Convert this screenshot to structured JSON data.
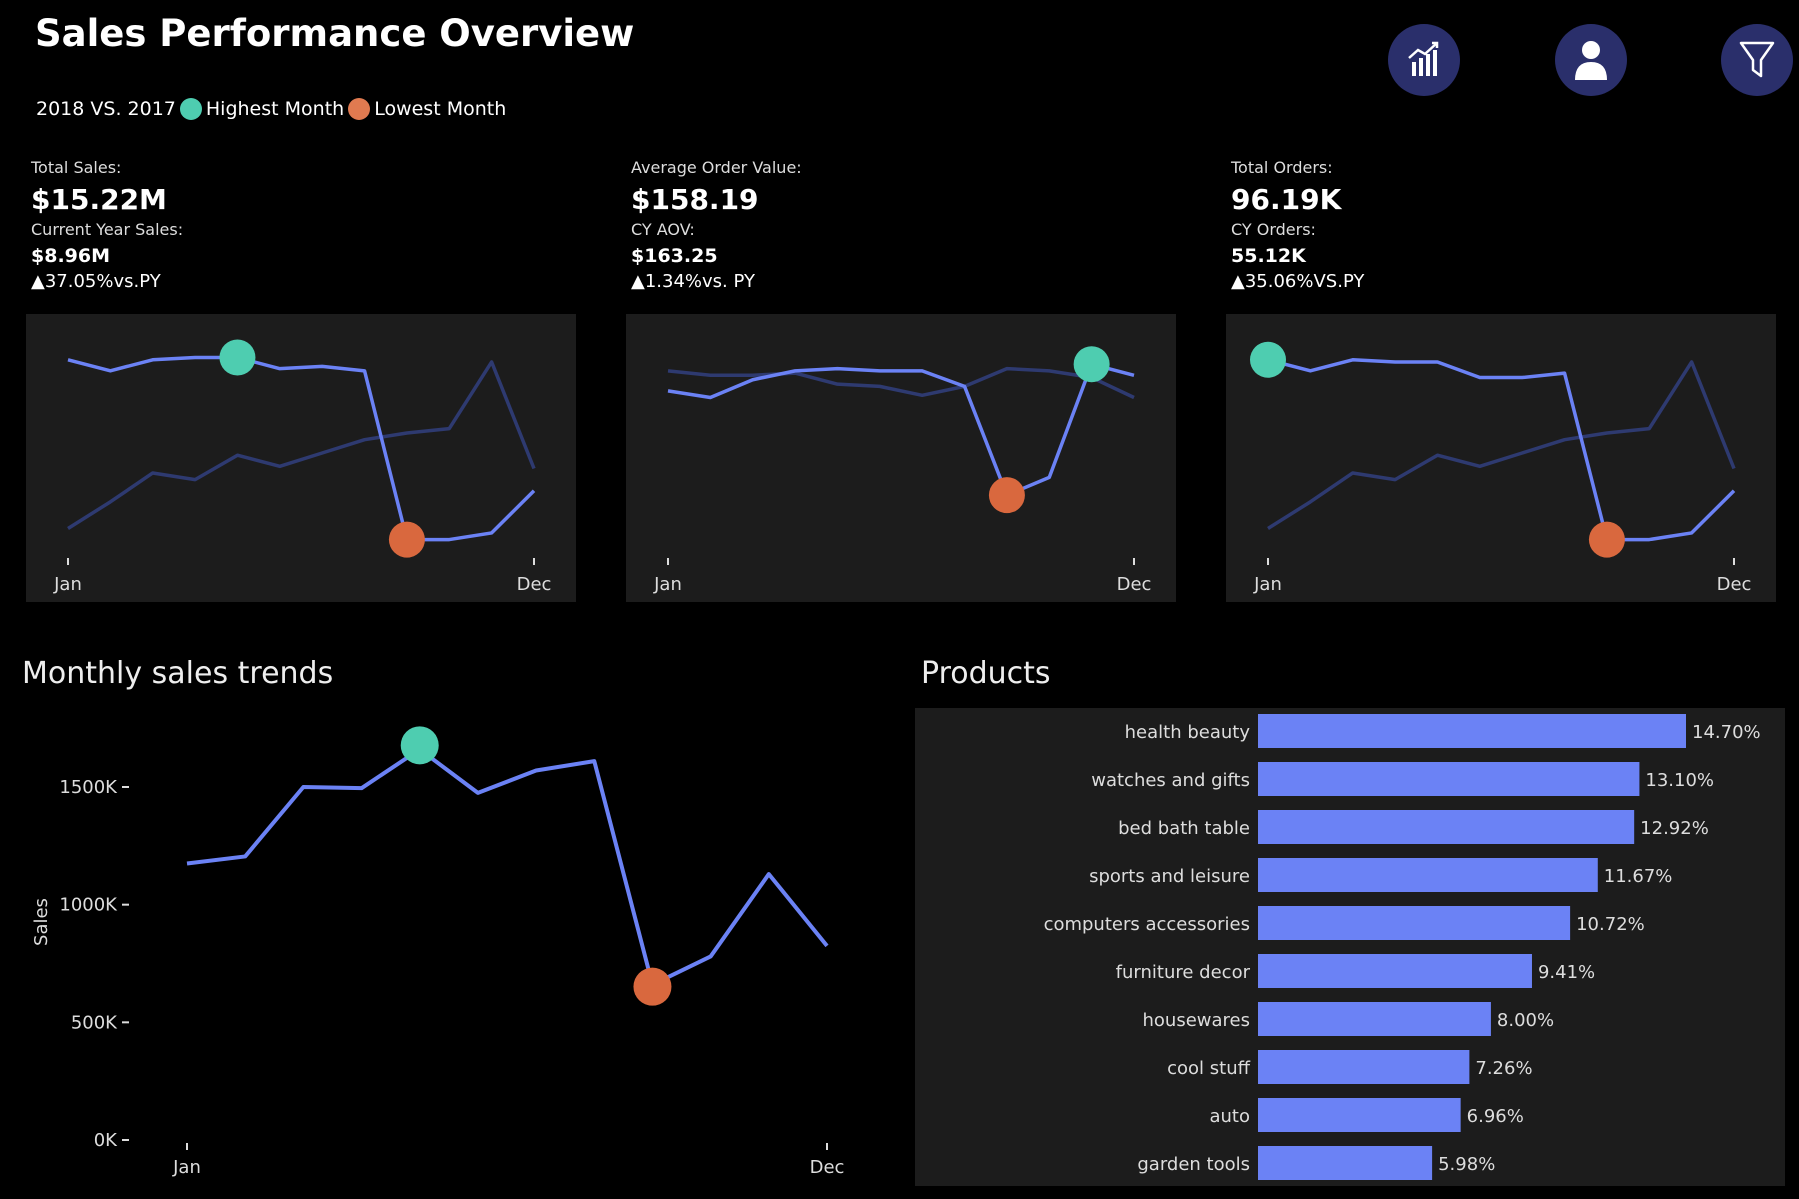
{
  "header": {
    "title": "Sales Performance Overview",
    "legend_prefix": "2018 VS. 2017",
    "legend_high": "Highest Month",
    "legend_low": "Lowest Month"
  },
  "colors": {
    "background": "#000000",
    "panel": "#1c1c1c",
    "current_year_line": "#6b82f5",
    "previous_year_line": "#2e3a70",
    "highest": "#4ecdb0",
    "lowest": "#d9683e",
    "bar": "#6b82f5",
    "icon_bg": "#2a2f6b"
  },
  "icons": [
    "chart-icon",
    "user-icon",
    "filter-icon"
  ],
  "kpis": [
    {
      "label": "Total Sales:",
      "value": "$15.22M",
      "cy_label": "Current Year Sales:",
      "cy_value": "$8.96M",
      "delta": "▲37.05%vs.PY",
      "x_start": "Jan",
      "x_end": "Dec"
    },
    {
      "label": "Average Order Value:",
      "value": "$158.19",
      "cy_label": "CY AOV:",
      "cy_value": "$163.25",
      "delta": "▲1.34%vs. PY",
      "x_start": "Jan",
      "x_end": "Dec"
    },
    {
      "label": "Total Orders:",
      "value": "96.19K",
      "cy_label": "CY Orders:",
      "cy_value": "55.12K",
      "delta": "▲35.06%VS.PY",
      "x_start": "Jan",
      "x_end": "Dec"
    }
  ],
  "sections": {
    "trend_title": "Monthly sales trends",
    "products_title": "Products"
  },
  "chart_data": [
    {
      "type": "line",
      "x": [
        1,
        2,
        3,
        4,
        5,
        6,
        7,
        8,
        9,
        10,
        11,
        12
      ],
      "x_tick_labels": [
        "Jan",
        "Dec"
      ],
      "series": [
        {
          "values": [
            0.92,
            0.87,
            0.92,
            0.93,
            0.93,
            0.88,
            0.89,
            0.87,
            0.11,
            0.11,
            0.14,
            0.33
          ],
          "highest_index": 4,
          "lowest_index": 8
        },
        {
          "values": [
            0.16,
            0.28,
            0.41,
            0.38,
            0.49,
            0.44,
            0.5,
            0.56,
            0.59,
            0.61,
            0.91,
            0.43
          ]
        }
      ],
      "ylim": [
        0,
        1
      ]
    },
    {
      "type": "line",
      "x": [
        1,
        2,
        3,
        4,
        5,
        6,
        7,
        8,
        9,
        10,
        11,
        12
      ],
      "x_tick_labels": [
        "Jan",
        "Dec"
      ],
      "series": [
        {
          "values": [
            0.78,
            0.75,
            0.83,
            0.87,
            0.88,
            0.87,
            0.87,
            0.8,
            0.31,
            0.39,
            0.9,
            0.85
          ],
          "highest_index": 10,
          "lowest_index": 8
        },
        {
          "values": [
            0.87,
            0.85,
            0.85,
            0.86,
            0.81,
            0.8,
            0.76,
            0.8,
            0.88,
            0.87,
            0.84,
            0.75
          ]
        }
      ],
      "ylim": [
        0,
        1
      ]
    },
    {
      "type": "line",
      "x": [
        1,
        2,
        3,
        4,
        5,
        6,
        7,
        8,
        9,
        10,
        11,
        12
      ],
      "x_tick_labels": [
        "Jan",
        "Dec"
      ],
      "series": [
        {
          "values": [
            0.92,
            0.87,
            0.92,
            0.91,
            0.91,
            0.84,
            0.84,
            0.86,
            0.11,
            0.11,
            0.14,
            0.33
          ],
          "highest_index": 0,
          "lowest_index": 8
        },
        {
          "values": [
            0.16,
            0.28,
            0.41,
            0.38,
            0.49,
            0.44,
            0.5,
            0.56,
            0.59,
            0.61,
            0.91,
            0.43
          ]
        }
      ],
      "ylim": [
        0,
        1
      ]
    },
    {
      "type": "line",
      "ylabel": "Sales",
      "x": [
        1,
        2,
        3,
        4,
        5,
        6,
        7,
        8,
        9,
        10,
        11,
        12
      ],
      "x_tick_labels": [
        "Jan",
        "Dec"
      ],
      "y_ticks": [
        0,
        500,
        1000,
        1500
      ],
      "y_tick_labels": [
        "0K",
        "500K",
        "1000K",
        "1500K"
      ],
      "ylim": [
        0,
        1850
      ],
      "series": [
        {
          "values": [
            1175,
            1205,
            1500,
            1495,
            1660,
            1475,
            1570,
            1610,
            660,
            780,
            1130,
            825
          ],
          "highest_index": 4,
          "lowest_index": 8
        }
      ]
    },
    {
      "type": "bar",
      "orientation": "horizontal",
      "categories": [
        "health beauty",
        "watches and gifts",
        "bed bath table",
        "sports and leisure",
        "computers accessories",
        "furniture decor",
        "housewares",
        "cool stuff",
        "auto",
        "garden tools"
      ],
      "values": [
        14.7,
        13.1,
        12.92,
        11.67,
        10.72,
        9.41,
        8.0,
        7.26,
        6.96,
        5.98
      ],
      "value_labels": [
        "14.70%",
        "13.10%",
        "12.92%",
        "11.67%",
        "10.72%",
        "9.41%",
        "8.00%",
        "7.26%",
        "6.96%",
        "5.98%"
      ],
      "xlim": [
        0,
        16
      ]
    }
  ]
}
